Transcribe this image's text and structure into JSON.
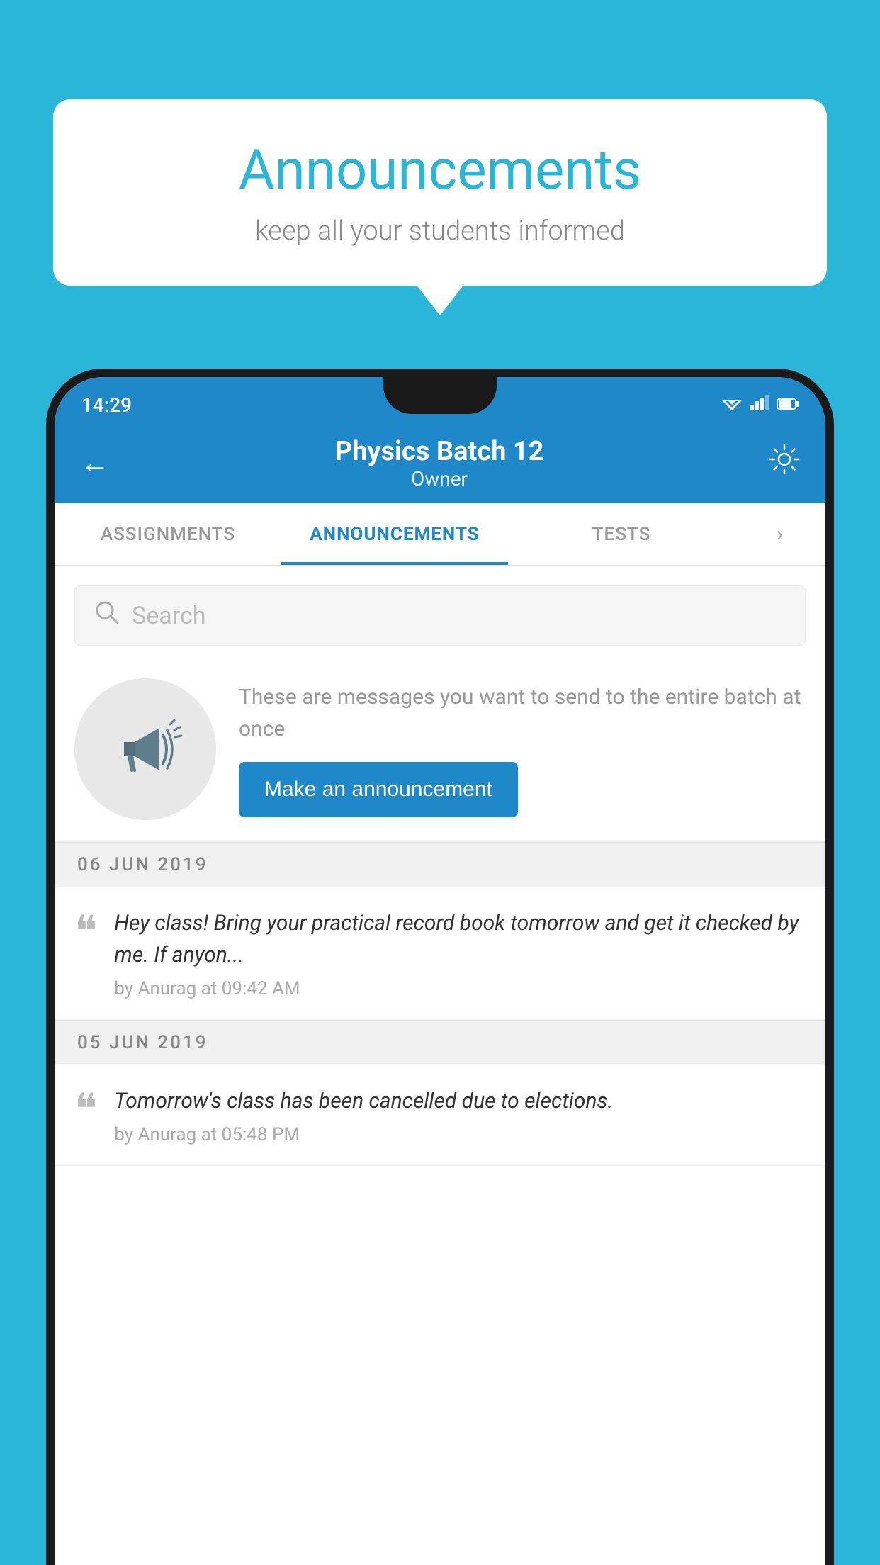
{
  "background_color": "#29b6d8",
  "speech_bubble": {
    "title": "Announcements",
    "subtitle": "keep all your students informed"
  },
  "status_bar": {
    "time": "14:29",
    "wifi": "▲",
    "signal": "▲",
    "battery": "▮"
  },
  "app_header": {
    "back_label": "←",
    "title": "Physics Batch 12",
    "subtitle": "Owner",
    "gear_label": "⚙"
  },
  "tabs": [
    {
      "label": "ASSIGNMENTS",
      "active": false
    },
    {
      "label": "ANNOUNCEMENTS",
      "active": true
    },
    {
      "label": "TESTS",
      "active": false
    },
    {
      "label": "•••",
      "active": false
    }
  ],
  "search": {
    "placeholder": "Search"
  },
  "empty_state": {
    "description": "These are messages you want to send to the entire batch at once",
    "button_label": "Make an announcement"
  },
  "date_groups": [
    {
      "date": "06  JUN  2019",
      "items": [
        {
          "text": "Hey class! Bring your practical record book tomorrow and get it checked by me. If anyon...",
          "meta": "by Anurag at 09:42 AM"
        }
      ]
    },
    {
      "date": "05  JUN  2019",
      "items": [
        {
          "text": "Tomorrow's class has been cancelled due to elections.",
          "meta": "by Anurag at 05:48 PM"
        }
      ]
    }
  ]
}
